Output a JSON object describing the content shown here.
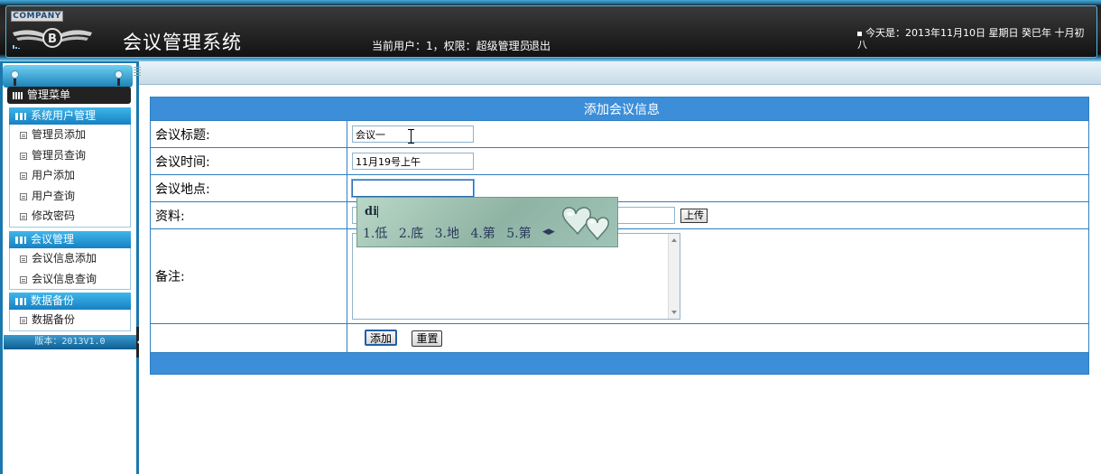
{
  "header": {
    "company_badge": "COMPANY",
    "app_title": "会议管理系统",
    "user_info": "当前用户：1，权限：超级管理员",
    "logout_label": "退出",
    "date_text": "今天是：2013年11月10日 星期日 癸巳年 十月初八"
  },
  "sidebar": {
    "menu_title": "管理菜单",
    "sections": [
      {
        "title": "系统用户管理",
        "items": [
          "管理员添加",
          "管理员查询",
          "用户添加",
          "用户查询",
          "修改密码"
        ]
      },
      {
        "title": "会议管理",
        "items": [
          "会议信息添加",
          "会议信息查询"
        ]
      },
      {
        "title": "数据备份",
        "items": [
          "数据备份"
        ]
      }
    ],
    "version": "版本：2013V1.0"
  },
  "form": {
    "header": "添加会议信息",
    "fields": {
      "title_label": "会议标题:",
      "title_value": "会议一",
      "time_label": "会议时间:",
      "time_value": "11月19号上午",
      "location_label": "会议地点:",
      "location_value": "",
      "material_label": "资料:",
      "upload_label": "上传",
      "notes_label": "备注:"
    },
    "add_button": "添加",
    "reset_button": "重置"
  },
  "ime": {
    "input": "di",
    "candidates": [
      "1.低",
      "2.底",
      "3.地",
      "4.第",
      "5.第"
    ]
  },
  "colors": {
    "accent": "#3d8ed8",
    "sidebar": "#1b78ae",
    "header_dark": "#1a1a1a"
  }
}
